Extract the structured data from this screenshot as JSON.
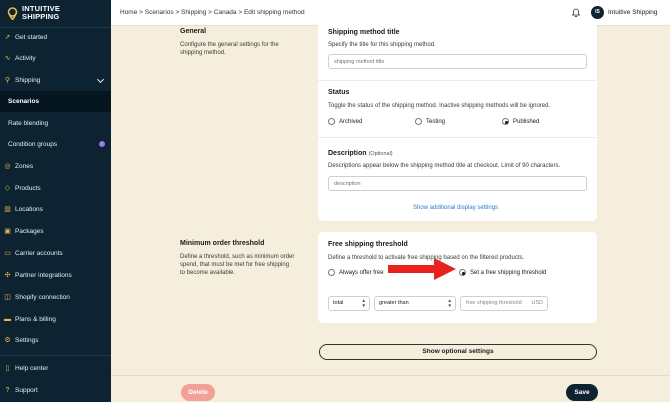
{
  "brand": {
    "line1": "INTUITIVE",
    "line2": "SHIPPING"
  },
  "sidebar": {
    "items": [
      {
        "label": "Get started",
        "icon": "rocket-icon"
      },
      {
        "label": "Activity",
        "icon": "activity-icon"
      },
      {
        "label": "Shipping",
        "icon": "truck-icon"
      },
      {
        "label": "Scenarios"
      },
      {
        "label": "Rate blending"
      },
      {
        "label": "Condition groups",
        "badge": "!"
      },
      {
        "label": "Zones",
        "icon": "globe-icon"
      },
      {
        "label": "Products",
        "icon": "box-icon"
      },
      {
        "label": "Locations",
        "icon": "building-icon"
      },
      {
        "label": "Packages",
        "icon": "package-icon"
      },
      {
        "label": "Carrier accounts",
        "icon": "truck-icon"
      },
      {
        "label": "Partner integrations",
        "icon": "puzzle-icon"
      },
      {
        "label": "Shopify connection",
        "icon": "bag-icon"
      },
      {
        "label": "Plans & billing",
        "icon": "card-icon"
      },
      {
        "label": "Settings",
        "icon": "gear-icon"
      },
      {
        "label": "Help center",
        "icon": "book-icon"
      },
      {
        "label": "Support",
        "icon": "help-icon"
      }
    ]
  },
  "header": {
    "breadcrumb": "Home > Scenarios > Shipping > Canada > Edit shipping method",
    "avatar": "IS",
    "account": "Intuitive Shipping"
  },
  "general": {
    "title": "General",
    "desc": "Configure the general settings for the shipping method.",
    "method_title": {
      "label": "Shipping method title",
      "desc": "Specify the title for this shipping method.",
      "placeholder": "shipping method title"
    },
    "status": {
      "label": "Status",
      "desc": "Toggle the status of the shipping method. Inactive shipping methods will be ignored.",
      "options": [
        "Archived",
        "Testing",
        "Published"
      ],
      "selected": "Published"
    },
    "description": {
      "label": "Description",
      "optional": "(Optional)",
      "desc": "Descriptions appear below the shipping method title at checkout. Limit of 90 characters.",
      "placeholder": "description"
    },
    "display_link": "Show additional display settings"
  },
  "threshold": {
    "title": "Minimum order threshold",
    "desc": "Define a threshold, such as minimum order spend, that must be met for free shipping to become available.",
    "card_title": "Free shipping threshold",
    "card_desc": "Define a threshold to activate free shipping based on the filtered products.",
    "options": [
      "Always offer free",
      "Set a free shipping threshold"
    ],
    "selected": "Set a free shipping threshold",
    "select1": "total",
    "select2": "greater than",
    "amount_placeholder": "free shipping threshold",
    "currency": "USD"
  },
  "optional_button": "Show optional settings",
  "footer": {
    "delete": "Delete",
    "save": "Save"
  },
  "colors": {
    "sidebar": "#0d2331",
    "accent": "#e8b84a",
    "page": "#f6eedd",
    "delete": "#f3a197",
    "arrow": "#e8211d"
  }
}
